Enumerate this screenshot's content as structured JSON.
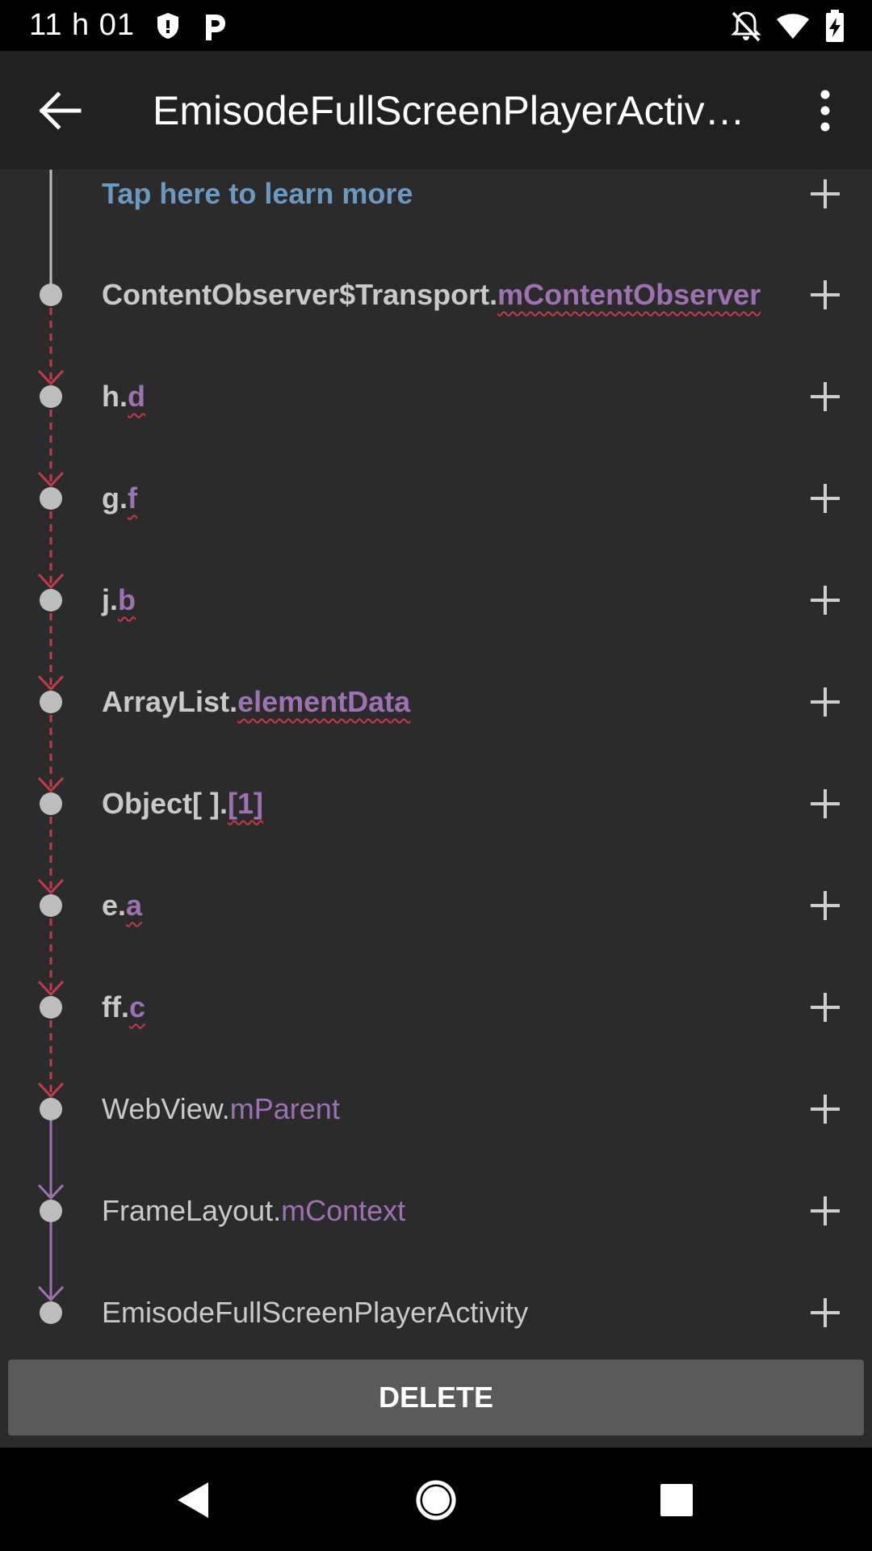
{
  "status_bar": {
    "time": "11 h 01",
    "icons": [
      "shield-icon",
      "p-app-icon",
      "notifications-off-icon",
      "wifi-icon",
      "battery-charging-icon"
    ]
  },
  "app_bar": {
    "title": "EmisodeFullScreenPlayerActiv…",
    "back_icon": "arrow-back-icon",
    "menu_icon": "more-vert-icon"
  },
  "list": {
    "learn_more": "Tap here to learn more",
    "rows": [
      {
        "class": "ContentObserver$Transport.",
        "field": "mContentObserver",
        "bold": true,
        "leak": true
      },
      {
        "class": "h.",
        "field": "d",
        "bold": true,
        "leak": true
      },
      {
        "class": "g.",
        "field": "f",
        "bold": true,
        "leak": true
      },
      {
        "class": "j.",
        "field": "b",
        "bold": true,
        "leak": true
      },
      {
        "class": "ArrayList.",
        "field": "elementData",
        "bold": true,
        "leak": true
      },
      {
        "class": "Object[ ].",
        "field": "[1]",
        "bold": true,
        "leak": true
      },
      {
        "class": "e.",
        "field": "a",
        "bold": true,
        "leak": true
      },
      {
        "class": "ff.",
        "field": "c",
        "bold": true,
        "leak": true
      },
      {
        "class": "WebView.",
        "field": "mParent",
        "bold": false,
        "leak": false
      },
      {
        "class": "FrameLayout.",
        "field": "mContext",
        "bold": false,
        "leak": false
      },
      {
        "class": "EmisodeFullScreenPlayerActivity",
        "field": "",
        "bold": false,
        "leak": false
      }
    ]
  },
  "colors": {
    "background": "#2b2b2b",
    "link": "#6c99bf",
    "field": "#9c72b2",
    "leak_line": "#c33a4a",
    "normal_line": "#9c72b2"
  },
  "actions": {
    "delete_label": "DELETE"
  },
  "nav_bar": {
    "icons": [
      "back-triangle-icon",
      "home-circle-icon",
      "recents-square-icon"
    ]
  }
}
